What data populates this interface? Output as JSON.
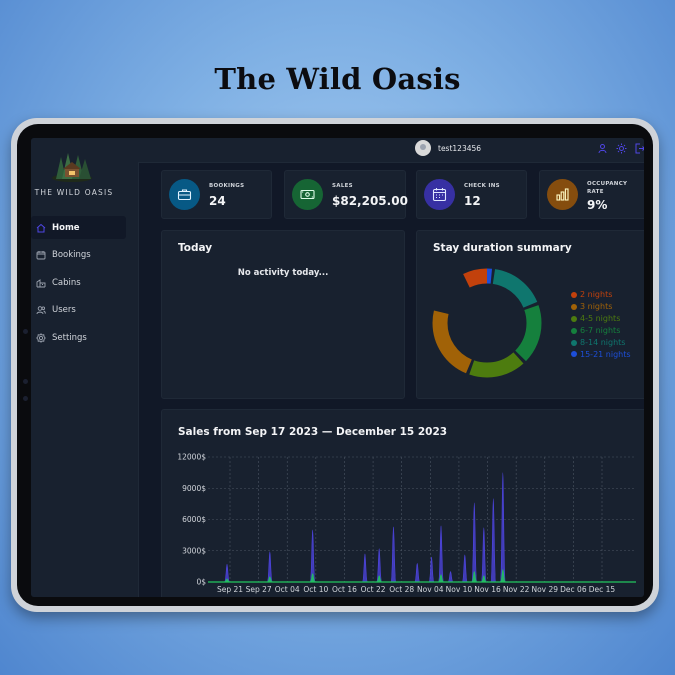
{
  "headline": "The Wild Oasis",
  "app": {
    "logo_text": "THE WILD OASIS",
    "user_name": "test123456"
  },
  "sidebar": {
    "items": [
      {
        "label": "Home",
        "icon": "home-icon",
        "active": true
      },
      {
        "label": "Bookings",
        "icon": "calendar-icon"
      },
      {
        "label": "Cabins",
        "icon": "cabins-icon"
      },
      {
        "label": "Users",
        "icon": "users-icon"
      },
      {
        "label": "Settings",
        "icon": "settings-icon"
      }
    ]
  },
  "header": {
    "icons": [
      "user-icon",
      "sun-icon",
      "logout-icon"
    ]
  },
  "stats": [
    {
      "label": "BOOKINGS",
      "value": "24",
      "icon": "briefcase-icon",
      "color": "#075985"
    },
    {
      "label": "SALES",
      "value": "$82,205.00",
      "icon": "banknotes-icon",
      "color": "#166534"
    },
    {
      "label": "CHECK INS",
      "value": "12",
      "icon": "calendar-days-icon",
      "color": "#3730a3"
    },
    {
      "label": "OCCUPANCY RATE",
      "value": "9%",
      "icon": "chart-bar-icon",
      "color": "#854d0e"
    }
  ],
  "today": {
    "title": "Today",
    "empty_text": "No activity today..."
  },
  "duration": {
    "title": "Stay duration summary",
    "legend": [
      {
        "label": "2 nights",
        "color": "#c2410c"
      },
      {
        "label": "3 nights",
        "color": "#a16207"
      },
      {
        "label": "4-5 nights",
        "color": "#4d7c0f"
      },
      {
        "label": "6-7 nights",
        "color": "#15803d"
      },
      {
        "label": "8-14 nights",
        "color": "#0f766e"
      },
      {
        "label": "15-21 nights",
        "color": "#1d4ed8"
      }
    ]
  },
  "chart_data": {
    "type": "area",
    "title": "Sales from Sep 17 2023 — December 15 2023",
    "y_ticks": [
      "12000$",
      "9000$",
      "6000$",
      "3000$",
      "0$"
    ],
    "x_ticks": [
      "Sep 21",
      "Sep 27",
      "Oct 04",
      "Oct 10",
      "Oct 16",
      "Oct 22",
      "Oct 28",
      "Nov 04",
      "Nov 10",
      "Nov 16",
      "Nov 22",
      "Nov 29",
      "Dec 06",
      "Dec 15"
    ],
    "ylim": [
      0,
      12000
    ],
    "grid": true,
    "series": [
      {
        "color": "#4f46e5",
        "points": [
          [
            4,
            1700
          ],
          [
            13,
            2900
          ],
          [
            22,
            5000
          ],
          [
            33,
            2700
          ],
          [
            36,
            3200
          ],
          [
            39,
            5300
          ],
          [
            44,
            1800
          ],
          [
            47,
            2400
          ],
          [
            49,
            5400
          ],
          [
            51,
            1000
          ],
          [
            54,
            2600
          ],
          [
            56,
            7600
          ],
          [
            58,
            5200
          ],
          [
            60,
            8000
          ],
          [
            62,
            10500
          ]
        ]
      },
      {
        "color": "#22c55e",
        "points": [
          [
            4,
            300
          ],
          [
            13,
            500
          ],
          [
            22,
            800
          ],
          [
            36,
            600
          ],
          [
            49,
            700
          ],
          [
            56,
            1000
          ],
          [
            58,
            600
          ],
          [
            62,
            1200
          ]
        ]
      }
    ]
  }
}
